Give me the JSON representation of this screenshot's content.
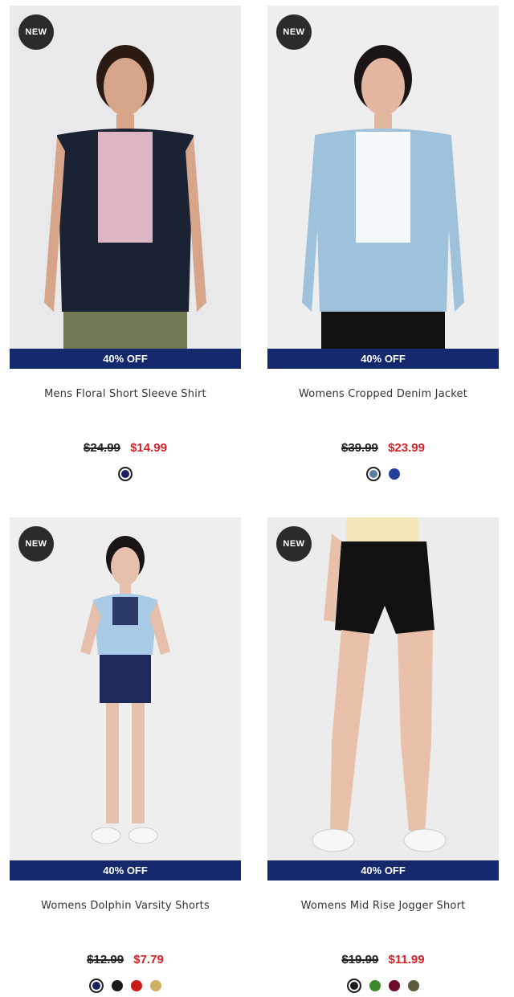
{
  "products": [
    {
      "name": "Mens Floral Short Sleeve Shirt",
      "badge": "NEW",
      "discount": "40% OFF",
      "old_price": "$24.99",
      "new_price": "$14.99",
      "swatches": [
        "#1b2160"
      ],
      "selected_swatch": 0,
      "photo_colors": {
        "bg": "#e9e9eb",
        "top": "#1b2233",
        "accent": "#f3c7d6",
        "bottom": "#6f7a55",
        "skin": "#d7a58a"
      }
    },
    {
      "name": "Womens Cropped Denim Jacket",
      "badge": "NEW",
      "discount": "40% OFF",
      "old_price": "$39.99",
      "new_price": "$23.99",
      "swatches": [
        "#5b7fa6",
        "#23419a"
      ],
      "selected_swatch": 0,
      "photo_colors": {
        "bg": "#eeeeee",
        "top": "#9ec2dc",
        "accent": "#ffffff",
        "bottom": "#111111",
        "skin": "#e3b6a0"
      }
    },
    {
      "name": "Womens Dolphin Varsity Shorts",
      "badge": "NEW",
      "discount": "40% OFF",
      "old_price": "$12.99",
      "new_price": "$7.79",
      "swatches": [
        "#1b2160",
        "#1a1a1a",
        "#c91919",
        "#cfb060"
      ],
      "selected_swatch": 0,
      "photo_colors": {
        "bg": "#eeeeee",
        "top": "#a9cbe6",
        "accent": "#1e2a5c",
        "bottom": "#1e2a5c",
        "skin": "#e6c0ac"
      }
    },
    {
      "name": "Womens Mid Rise Jogger Short",
      "badge": "NEW",
      "discount": "40% OFF",
      "old_price": "$19.99",
      "new_price": "$11.99",
      "swatches": [
        "#1a1a1a",
        "#3a8a2c",
        "#6e0b26",
        "#5d5a3c"
      ],
      "selected_swatch": 0,
      "photo_colors": {
        "bg": "#ececec",
        "top": "#f3e6b8",
        "accent": "#ffffff",
        "bottom": "#111111",
        "skin": "#e9c1aa"
      }
    }
  ]
}
